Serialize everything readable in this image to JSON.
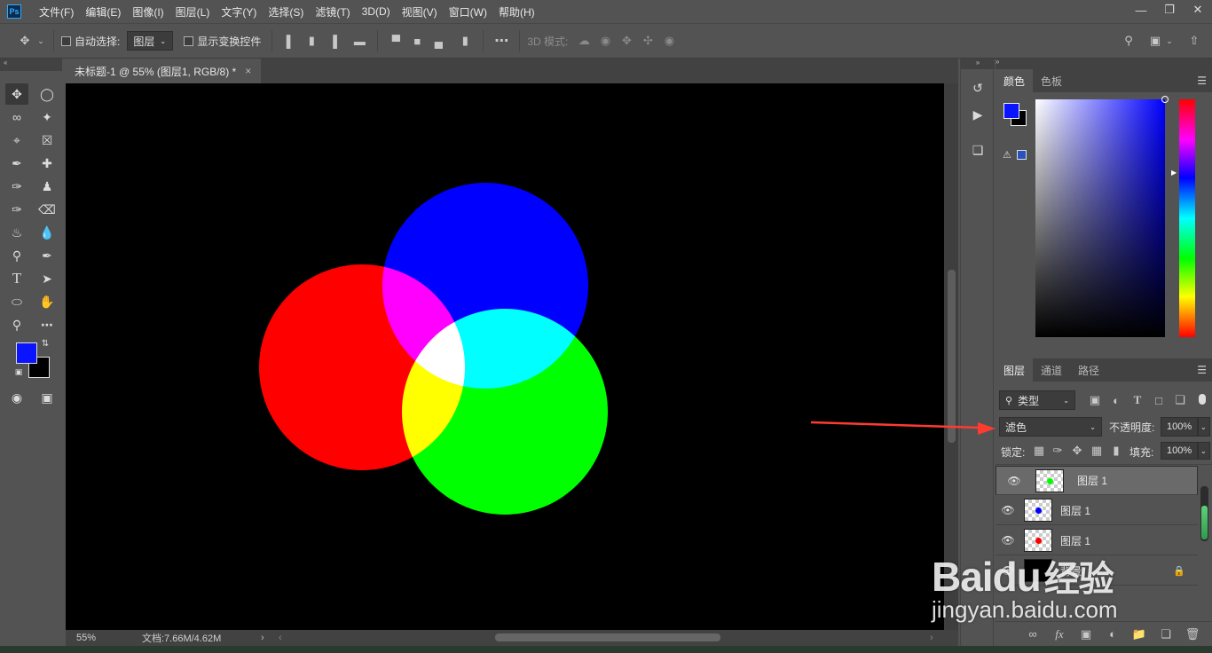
{
  "app": {
    "logo_text": "Ps"
  },
  "menu": [
    "文件(F)",
    "编辑(E)",
    "图像(I)",
    "图层(L)",
    "文字(Y)",
    "选择(S)",
    "滤镜(T)",
    "3D(D)",
    "视图(V)",
    "窗口(W)",
    "帮助(H)"
  ],
  "options": {
    "auto_select_label": "自动选择:",
    "auto_select_value": "图层",
    "show_transform_label": "显示变换控件",
    "mode3d_label": "3D 模式:"
  },
  "document": {
    "tab_title": "未标题-1 @ 55% (图层1, RGB/8) *",
    "close": "×",
    "zoom": "55%",
    "doc_info": "文档:7.66M/4.62M",
    "bg_color": "#000000",
    "circles": [
      {
        "name": "blue-circle",
        "color": "#0000ff"
      },
      {
        "name": "red-circle",
        "color": "#ff0000"
      },
      {
        "name": "green-circle",
        "color": "#00ff00"
      }
    ],
    "blend": "screen"
  },
  "tools": {
    "foreground_color": "#0a14ff",
    "background_color": "#000000"
  },
  "color_panel": {
    "tabs": [
      "颜色",
      "色板"
    ],
    "hue_color": "#0000ff"
  },
  "layers_panel": {
    "tabs": [
      "图层",
      "通道",
      "路径"
    ],
    "filter_kind": "类型",
    "blend_mode": "滤色",
    "opacity_label": "不透明度:",
    "opacity_value": "100%",
    "lock_label": "锁定:",
    "fill_label": "填充:",
    "fill_value": "100%",
    "layers": [
      {
        "name": "图层 1",
        "dot_color": "#00ff00",
        "selected": true
      },
      {
        "name": "图层 1",
        "dot_color": "#0000ff",
        "selected": false
      },
      {
        "name": "图层 1",
        "dot_color": "#ff0000",
        "selected": false
      },
      {
        "name": "背景",
        "dot_color": "",
        "selected": false
      }
    ]
  },
  "watermark": {
    "brand": "Baidu",
    "brand_cn": "经验",
    "url": "jingyan.baidu.com"
  },
  "annotation": {
    "arrow_color": "#ff3b30"
  }
}
